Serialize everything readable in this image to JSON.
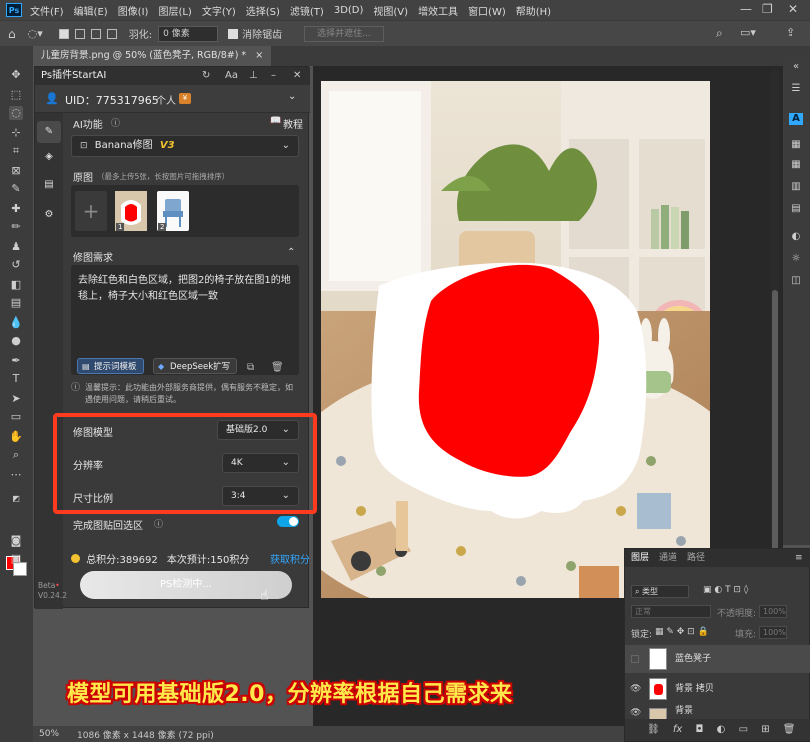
{
  "app": {
    "menu": [
      "文件(F)",
      "编辑(E)",
      "图像(I)",
      "图层(L)",
      "文字(Y)",
      "选择(S)",
      "滤镜(T)",
      "3D(D)",
      "视图(V)",
      "增效工具",
      "窗口(W)",
      "帮助(H)"
    ],
    "ps_logo": "Ps",
    "window_controls": [
      "—",
      "❐",
      "✕"
    ]
  },
  "options": {
    "feather_label": "羽化:",
    "feather_value": "0 像素",
    "antialias_label": "消除锯齿",
    "select_subject_label": "选择并遮住..."
  },
  "document": {
    "tab_title": "儿童房背景.png @ 50% (蓝色凳子, RGB/8#) *",
    "tab_close": "×",
    "status_zoom": "50%",
    "status_info": "1086 像素 x 1448 像素 (72 ppi)"
  },
  "plugin": {
    "title": "Ps插件StartAI",
    "uid": "UID：775317965",
    "account_type": "个人",
    "ai_function_label": "AI功能",
    "tutorial_label": "教程",
    "model_select": "Banana修图",
    "model_badge": "V3",
    "original_label": "原图",
    "original_hint": "（最多上传5张，长按图片可拖拽排序）",
    "add_symbol": "+",
    "thumb_index_1": "1",
    "thumb_index_2": "2",
    "requirement_label": "修图需求",
    "requirement_text": "去除红色和白色区域，把图2的椅子放在图1的地毯上，椅子大小和红色区域一致",
    "prompt_template_btn": "提示词模板",
    "deepseek_btn": "DeepSeek扩写",
    "warning_text": "温馨提示：此功能由外部服务商提供，偶有服务不稳定，如遇使用问题，请稍后重试。",
    "model_label": "修图模型",
    "model_value": "基础版2.0",
    "resolution_label": "分辨率",
    "resolution_value": "4K",
    "ratio_label": "尺寸比例",
    "ratio_value": "3:4",
    "paste_back_label": "完成图贴回选区",
    "total_points": "总积分:389692",
    "estimate": "本次预计:150积分",
    "get_points": "获取积分",
    "detect_button": "PS检测中...",
    "beta_label": "Beta",
    "version": "V0.24.2"
  },
  "layers": {
    "tabs": [
      "图层",
      "通道",
      "路径"
    ],
    "kind_filter": "类型",
    "blend_mode": "正常",
    "opacity_label": "不透明度:",
    "opacity_value": "100%",
    "lock_label": "锁定:",
    "fill_label": "填充:",
    "fill_value": "100%",
    "items": [
      {
        "name": "蓝色凳子"
      },
      {
        "name": "背景 拷贝"
      },
      {
        "name": "背景"
      }
    ]
  },
  "caption": "模型可用基础版2.0，分辨率根据自己需求来",
  "colors": {
    "accent": "#31a8ff",
    "annotation": "#ff3b1f",
    "toggle": "#0ea5e9",
    "caption_fill": "#ffe94a",
    "caption_outline": "#cc0000",
    "mask_red": "#ff0000"
  }
}
